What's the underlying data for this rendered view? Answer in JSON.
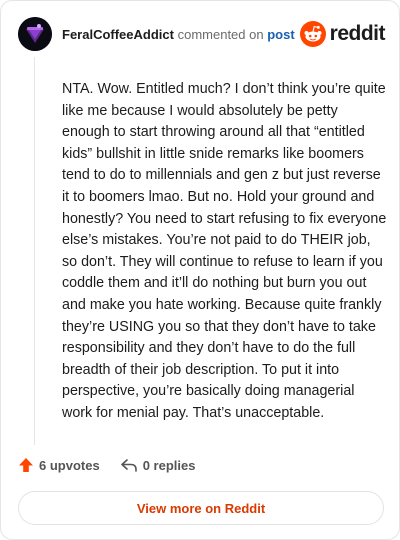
{
  "header": {
    "username": "FeralCoffeeAddict",
    "action_text": "commented on",
    "post_link": "post",
    "brand": "reddit"
  },
  "comment": {
    "body": "NTA. Wow. Entitled much? I don’t think you’re quite like me because I would absolutely be petty enough to start throwing around all that “entitled kids” bullshit in little snide remarks like boomers tend to do to millennials and gen z but just reverse it to boomers lmao. But no. Hold your ground and honestly? You need to start refusing to fix everyone else’s mistakes. You’re not paid to do THEIR job, so don’t. They will continue to refuse to learn if you coddle them and it’ll do nothing but burn you out and make you hate working. Because quite frankly they’re USING you so that they don’t have to take responsibility and they don’t have to do the full breadth of their job description. To put it into perspective, you’re basically doing managerial work for menial pay. That’s unacceptable."
  },
  "actions": {
    "upvotes": "6 upvotes",
    "replies": "0 replies"
  },
  "footer": {
    "view_more": "View more on Reddit"
  },
  "icons": {
    "avatar": "avatar-image",
    "logo": "reddit-logo-icon",
    "upvote": "upvote-arrow-icon",
    "reply": "reply-arrow-icon"
  },
  "colors": {
    "brand_orange": "#ff4500",
    "link_blue": "#1a5fb4",
    "cta_text": "#d93a00"
  }
}
